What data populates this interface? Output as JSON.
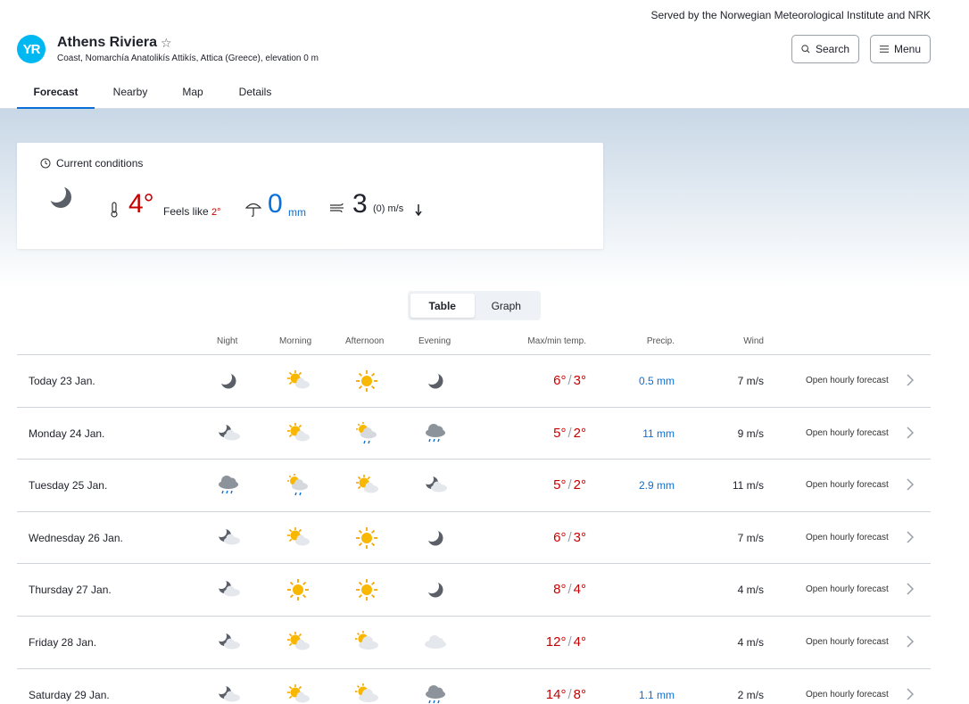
{
  "header": {
    "served_by": "Served by the Norwegian Meteorological Institute and NRK",
    "logo_text": "YR",
    "location_name": "Athens Riviera",
    "location_sub": "Coast, Nomarchía Anatolikís Attikís, Attica (Greece), elevation 0 m",
    "search_label": "Search",
    "menu_label": "Menu",
    "tabs": [
      {
        "label": "Forecast",
        "active": true
      },
      {
        "label": "Nearby"
      },
      {
        "label": "Map"
      },
      {
        "label": "Details"
      }
    ]
  },
  "current": {
    "title": "Current conditions",
    "temperature": "4°",
    "feels_like_label": "Feels like",
    "feels_like": "2°",
    "precipitation": "0",
    "precip_unit": "mm",
    "wind": "3",
    "gust_unit": "(0) m/s"
  },
  "view_toggle": {
    "table": "Table",
    "graph": "Graph"
  },
  "table": {
    "headers": {
      "night": "Night",
      "morning": "Morning",
      "afternoon": "Afternoon",
      "evening": "Evening",
      "temp": "Max/min temp.",
      "precip": "Precip.",
      "wind": "Wind"
    },
    "open_label": "Open hourly forecast",
    "rows": [
      {
        "day": "Today 23 Jan.",
        "icons": [
          "moon",
          "sun-cloud",
          "sun",
          "moon"
        ],
        "max": "6°",
        "min": "3°",
        "precip": "0.5 mm",
        "wind": "7 m/s"
      },
      {
        "day": "Monday 24 Jan.",
        "icons": [
          "moon-cloud",
          "sun-cloud",
          "sun-rain",
          "rain"
        ],
        "max": "5°",
        "min": "2°",
        "precip": "11 mm",
        "wind": "9 m/s"
      },
      {
        "day": "Tuesday 25 Jan.",
        "icons": [
          "rain",
          "sun-rain",
          "sun-cloud",
          "moon-cloud"
        ],
        "max": "5°",
        "min": "2°",
        "precip": "2.9 mm",
        "wind": "11 m/s"
      },
      {
        "day": "Wednesday 26 Jan.",
        "icons": [
          "moon-cloud",
          "sun-cloud",
          "sun",
          "moon"
        ],
        "max": "6°",
        "min": "3°",
        "precip": "",
        "wind": "7 m/s"
      },
      {
        "day": "Thursday 27 Jan.",
        "icons": [
          "moon-cloud",
          "sun",
          "sun",
          "moon"
        ],
        "max": "8°",
        "min": "4°",
        "precip": "",
        "wind": "4 m/s"
      },
      {
        "day": "Friday 28 Jan.",
        "icons": [
          "moon-cloud",
          "sun-cloud",
          "sun-cloud-big",
          "cloud"
        ],
        "max": "12°",
        "min": "4°",
        "precip": "",
        "wind": "4 m/s"
      },
      {
        "day": "Saturday 29 Jan.",
        "icons": [
          "moon-cloud",
          "sun-cloud",
          "sun-cloud-big",
          "rain"
        ],
        "max": "14°",
        "min": "8°",
        "precip": "1.1 mm",
        "wind": "2 m/s"
      }
    ]
  },
  "colors": {
    "warm": "#c60000",
    "precip": "#0a6fd6",
    "accent": "#00b8f1"
  }
}
